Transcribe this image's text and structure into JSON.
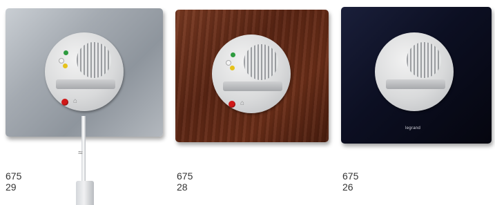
{
  "products": [
    {
      "finish": "aluminium",
      "code": "675 29",
      "has_cord": true
    },
    {
      "finish": "wood",
      "code": "675 28",
      "has_cord": false
    },
    {
      "finish": "black",
      "code": "675 26",
      "has_cord": false,
      "brand_label": "legrand"
    }
  ],
  "colors": {
    "aluminium": "#a4aab1",
    "wood": "#5c2614",
    "black": "#0c0f22",
    "led_green": "#2e9b3f",
    "led_yellow": "#e5c21c",
    "button_red": "#d01818"
  }
}
